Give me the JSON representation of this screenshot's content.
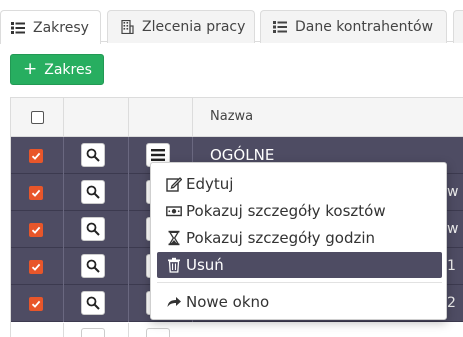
{
  "tabs": [
    {
      "label": "Zakresy",
      "icon": "list-icon",
      "active": true
    },
    {
      "label": "Zlecenia pracy",
      "icon": "building-icon",
      "active": false
    },
    {
      "label": "Dane kontrahentów",
      "icon": "list-icon",
      "active": false
    }
  ],
  "toolbar": {
    "add_label": "Zakres",
    "add_icon": "plus-icon",
    "add_color": "#27ae60"
  },
  "table": {
    "columns": [
      "",
      "",
      "",
      "Nazwa"
    ],
    "rows": [
      {
        "checked": true,
        "name": "OGÓLNE",
        "tail": ""
      },
      {
        "checked": true,
        "name": "",
        "tail": "w"
      },
      {
        "checked": true,
        "name": "",
        "tail": "w"
      },
      {
        "checked": true,
        "name": "",
        "tail": "1"
      },
      {
        "checked": true,
        "name": "",
        "tail": "2"
      }
    ],
    "selected_row_color": "#4e4c63",
    "checkbox_color": "#e8562a"
  },
  "context_menu": {
    "items": [
      {
        "label": "Edytuj",
        "icon": "edit-icon"
      },
      {
        "label": "Pokazuj szczegóły kosztów",
        "icon": "money-icon"
      },
      {
        "label": "Pokazuj szczegóły godzin",
        "icon": "hourglass-icon"
      },
      {
        "label": "Usuń",
        "icon": "trash-icon",
        "highlighted": true
      },
      {
        "label": "Nowe okno",
        "icon": "share-arrow-icon"
      }
    ]
  }
}
